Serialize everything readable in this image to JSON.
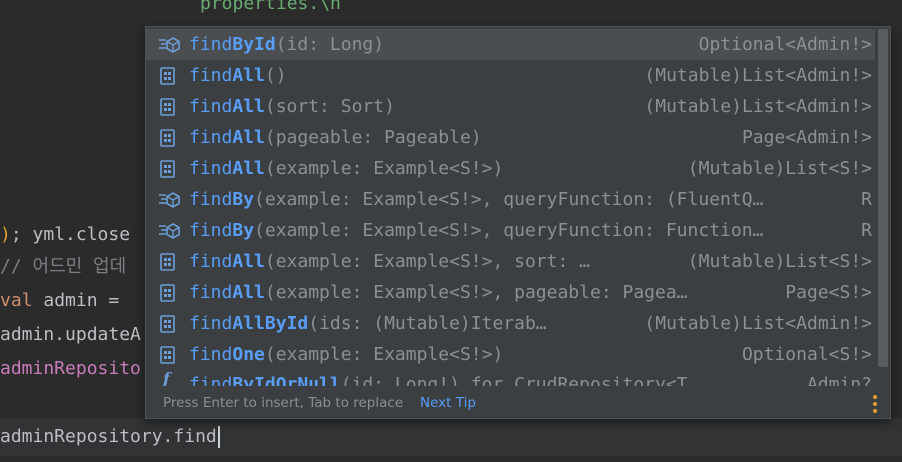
{
  "editor": {
    "lines": [
      {
        "id": "l1",
        "text": "properties.\\n"
      },
      {
        "id": "l2",
        "text": "); yml.close"
      },
      {
        "id": "l3",
        "text": "// 어드민 업데"
      },
      {
        "id": "l4_kw",
        "text": "val"
      },
      {
        "id": "l4_rest",
        "text": " admin = "
      },
      {
        "id": "l5",
        "text": "admin.updateA"
      },
      {
        "id": "l6",
        "text": "adminReposito"
      },
      {
        "id": "current",
        "text": "adminRepository.find"
      }
    ]
  },
  "completion": {
    "items": [
      {
        "icon": "method-override-icon",
        "name": "findById",
        "bold": "ById",
        "params": "(id: Long)",
        "ret": "Optional<Admin!>"
      },
      {
        "icon": "method-icon",
        "name": "findAll",
        "bold": "All",
        "params": "()",
        "ret": "(Mutable)List<Admin!>"
      },
      {
        "icon": "method-icon",
        "name": "findAll",
        "bold": "All",
        "params": "(sort: Sort)",
        "ret": "(Mutable)List<Admin!>"
      },
      {
        "icon": "method-icon",
        "name": "findAll",
        "bold": "All",
        "params": "(pageable: Pageable)",
        "ret": "Page<Admin!>"
      },
      {
        "icon": "method-icon",
        "name": "findAll",
        "bold": "All",
        "params": "(example: Example<S!>)",
        "ret": "(Mutable)List<S!>"
      },
      {
        "icon": "method-override-icon",
        "name": "findBy",
        "bold": "By",
        "params": "(example: Example<S!>, queryFunction: (FluentQ…",
        "ret": "R"
      },
      {
        "icon": "method-override-icon",
        "name": "findBy",
        "bold": "By",
        "params": "(example: Example<S!>, queryFunction: Function…",
        "ret": "R"
      },
      {
        "icon": "method-icon",
        "name": "findAll",
        "bold": "All",
        "params": "(example: Example<S!>, sort: …",
        "ret": "(Mutable)List<S!>"
      },
      {
        "icon": "method-icon",
        "name": "findAll",
        "bold": "All",
        "params": "(example: Example<S!>, pageable: Pagea…",
        "ret": "Page<S!>"
      },
      {
        "icon": "method-icon",
        "name": "findAllById",
        "bold": "AllById",
        "params": "(ids: (Mutable)Iterab…",
        "ret": "(Mutable)List<Admin!>"
      },
      {
        "icon": "method-icon",
        "name": "findOne",
        "bold": "One",
        "params": "(example: Example<S!>)",
        "ret": "Optional<S!>"
      },
      {
        "icon": "function-icon",
        "name": "findByIdOrNull",
        "bold": "ByIdOrNull",
        "params": "(id: Long!) for CrudRepository<T, …",
        "ret": "Admin?"
      }
    ],
    "footer": {
      "hint": "Press Enter to insert, Tab to replace",
      "next_tip": "Next Tip"
    }
  }
}
